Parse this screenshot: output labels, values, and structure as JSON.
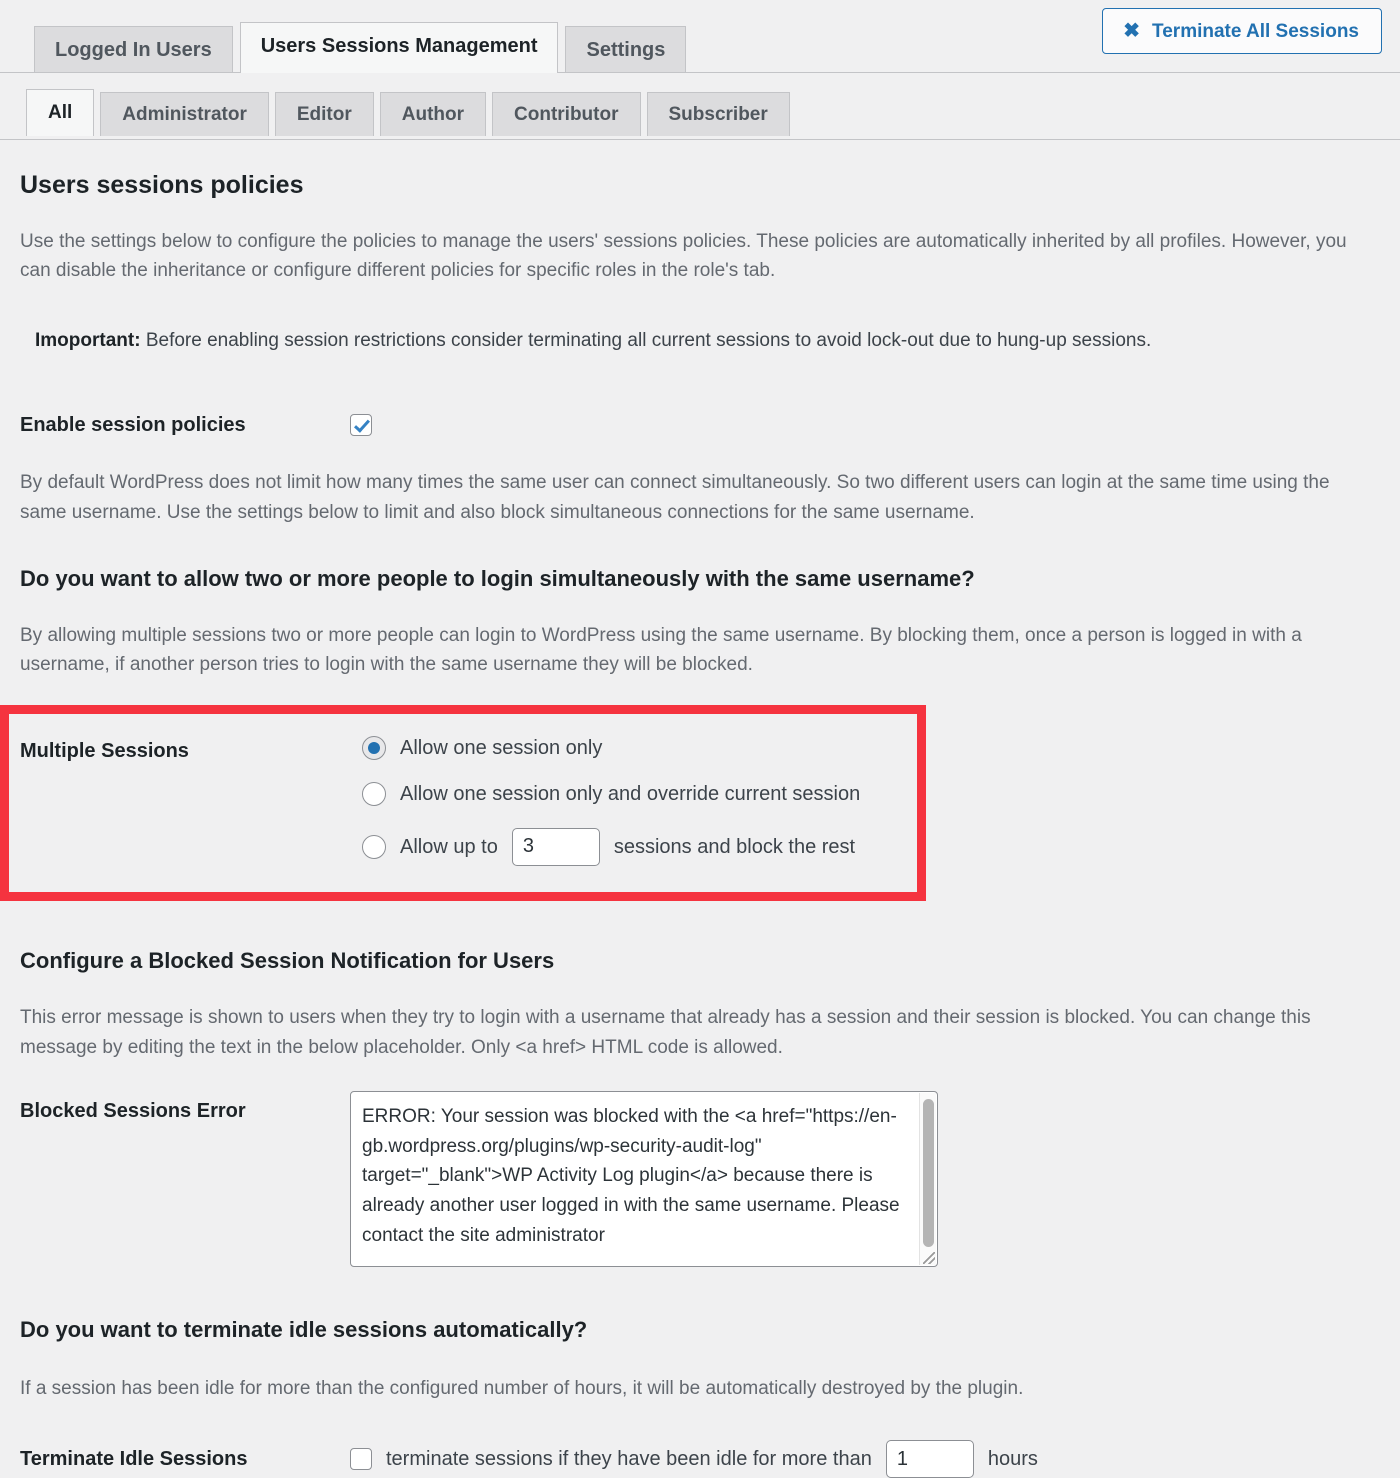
{
  "primary_tabs": [
    {
      "label": "Logged In Users",
      "active": false
    },
    {
      "label": "Users Sessions Management",
      "active": true
    },
    {
      "label": "Settings",
      "active": false
    }
  ],
  "terminate_button": {
    "label": "Terminate All Sessions",
    "icon": "close-x-icon",
    "icon_glyph": "✖",
    "accent_color": "#2271b1"
  },
  "role_tabs": [
    {
      "label": "All",
      "active": true
    },
    {
      "label": "Administrator",
      "active": false
    },
    {
      "label": "Editor",
      "active": false
    },
    {
      "label": "Author",
      "active": false
    },
    {
      "label": "Contributor",
      "active": false
    },
    {
      "label": "Subscriber",
      "active": false
    }
  ],
  "policies": {
    "title": "Users sessions policies",
    "intro": "Use the settings below to configure the policies to manage the users' sessions policies. These policies are automatically inherited by all profiles. However, you can disable the inheritance or configure different policies for specific roles in the role's tab.",
    "important_label": "Imoportant:",
    "important_text": "Before enabling session restrictions consider terminating all current sessions to avoid lock-out due to hung-up sessions.",
    "enable_label": "Enable session policies",
    "enable_checked": true,
    "enable_description": "By default WordPress does not limit how many times the same user can connect simultaneously. So two different users can login at the same time using the same username. Use the settings below to limit and also block simultaneous connections for the same username."
  },
  "multiple_sessions": {
    "question": "Do you want to allow two or more people to login simultaneously with the same username?",
    "description": "By allowing multiple sessions two or more people can login to WordPress using the same username. By blocking them, once a person is logged in with a username, if another person tries to login with the same username they will be blocked.",
    "label": "Multiple Sessions",
    "highlight_color": "#f5333f",
    "options": [
      {
        "label": "Allow one session only",
        "selected": true
      },
      {
        "label": "Allow one session only and override current session",
        "selected": false
      },
      {
        "label": "Allow up to",
        "selected": false,
        "suffix": "sessions and block the rest",
        "value": "3"
      }
    ]
  },
  "blocked_notification": {
    "question": "Configure a Blocked Session Notification for Users",
    "description": "This error message is shown to users when they try to login with a username that already has a session and their session is blocked. You can change this message by editing the text in the below placeholder. Only <a href> HTML code is allowed.",
    "label": "Blocked Sessions Error",
    "value": "ERROR: Your session was blocked with the <a href=\"https://en-gb.wordpress.org/plugins/wp-security-audit-log\" target=\"_blank\">WP Activity Log plugin</a> because there is already another user logged in with the same username. Please contact the site administrator"
  },
  "idle_sessions": {
    "question": "Do you want to terminate idle sessions automatically?",
    "description": "If a session has been idle for more than the configured number of hours, it will be automatically destroyed by the plugin.",
    "label": "Terminate Idle Sessions",
    "checkbox_checked": false,
    "text_before": "terminate sessions if they have been idle for more than",
    "value": "1",
    "text_after": "hours"
  }
}
